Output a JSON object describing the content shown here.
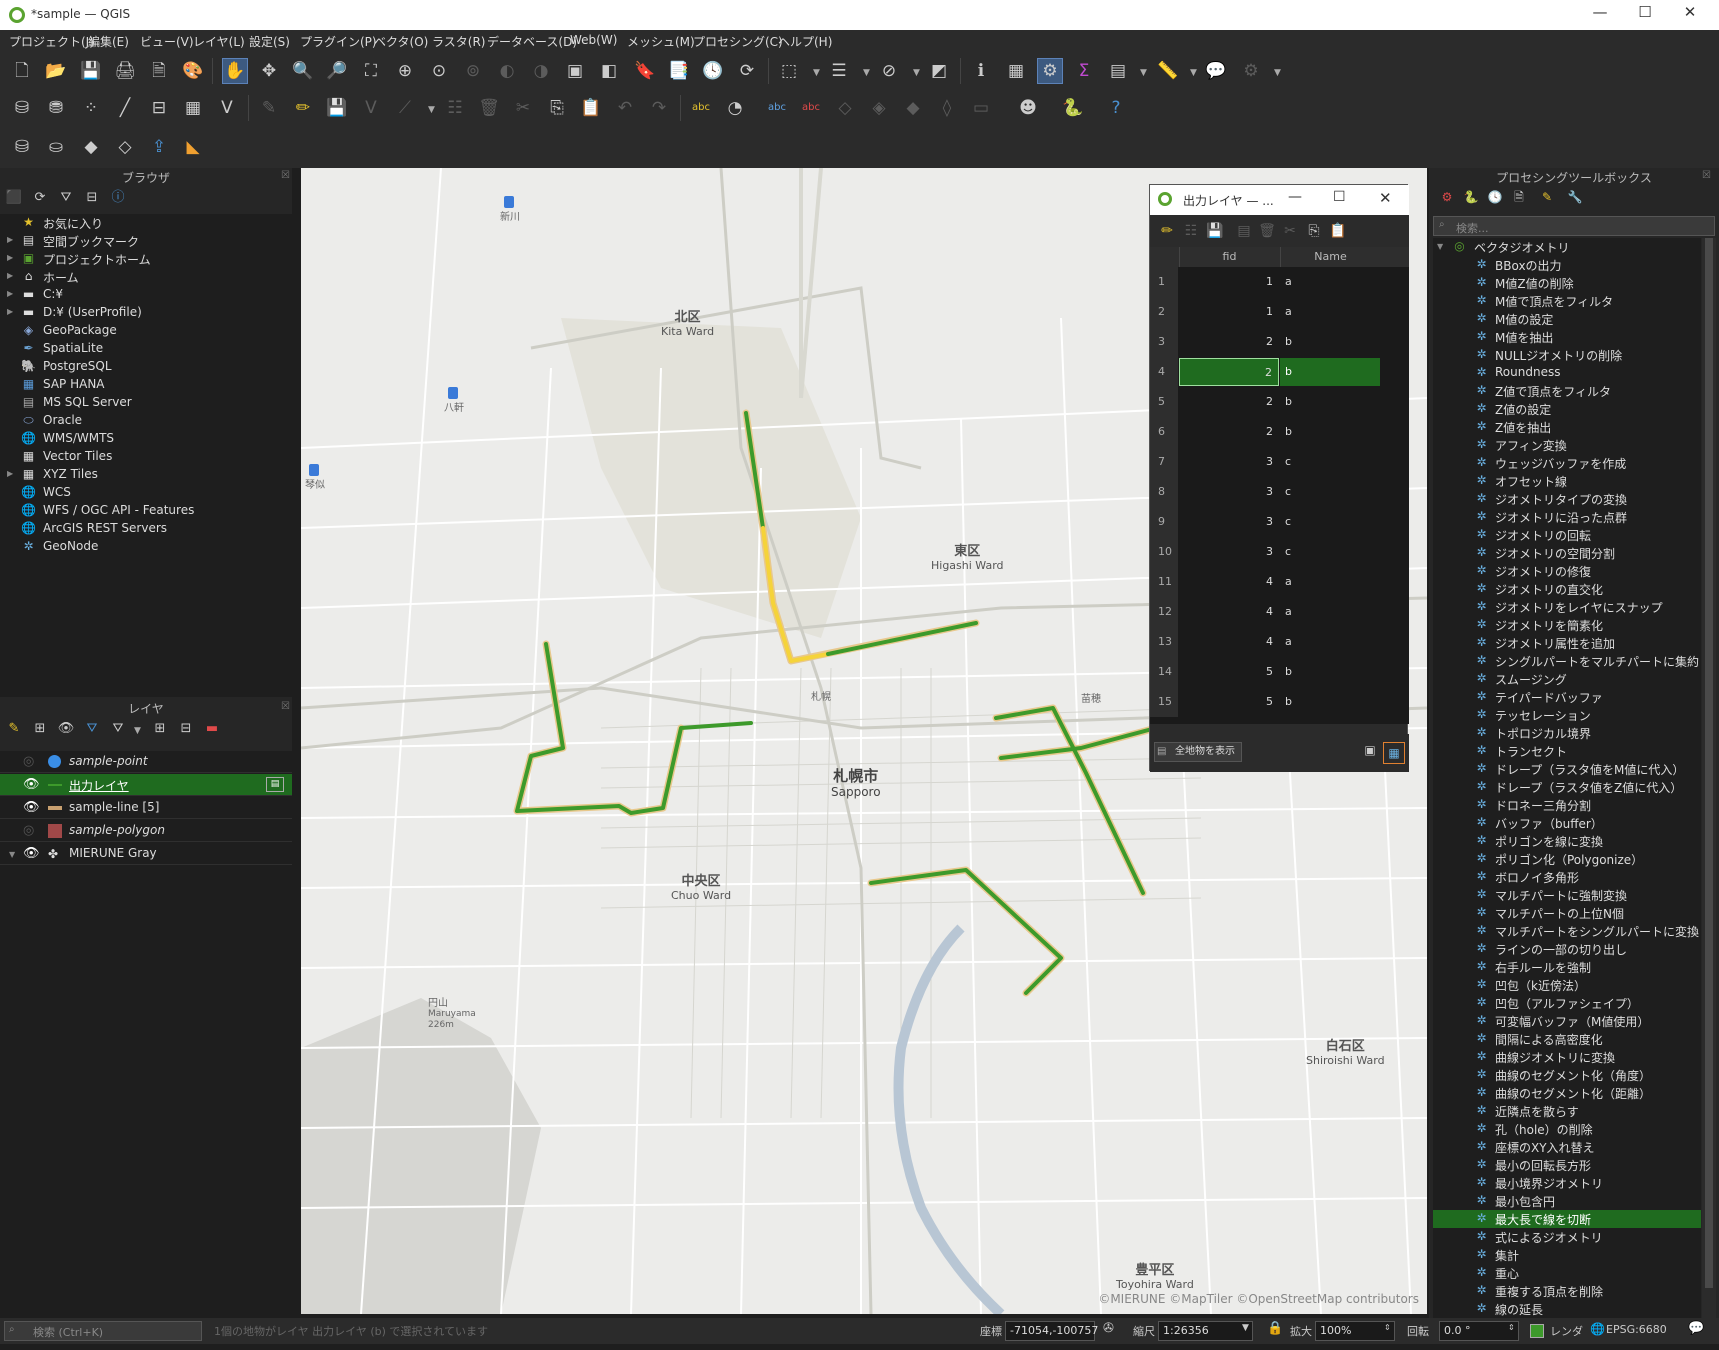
{
  "window": {
    "title": "*sample — QGIS",
    "minimize": "—",
    "maximize": "☐",
    "close": "✕"
  },
  "menu": [
    "プロジェクト(J)",
    "編集(E)",
    "ビュー(V)",
    "レイヤ(L)",
    "設定(S)",
    "プラグイン(P)",
    "ベクタ(O)",
    "ラスタ(R)",
    "データベース(D)",
    "Web(W)",
    "メッシュ(M)",
    "プロセシング(C)",
    "ヘルプ(H)"
  ],
  "browser": {
    "title": "ブラウザ",
    "items": [
      {
        "label": "お気に入り",
        "icon": "star-icon",
        "expand": false
      },
      {
        "label": "空間ブックマーク",
        "icon": "bookmark-icon",
        "expand": true
      },
      {
        "label": "プロジェクトホーム",
        "icon": "project-home-icon",
        "expand": true
      },
      {
        "label": "ホーム",
        "icon": "home-icon",
        "expand": true
      },
      {
        "label": "C:¥",
        "icon": "drive-icon",
        "expand": true
      },
      {
        "label": "D:¥ (UserProfile)",
        "icon": "drive-icon",
        "expand": true
      },
      {
        "label": "GeoPackage",
        "icon": "geopackage-icon",
        "expand": false
      },
      {
        "label": "SpatiaLite",
        "icon": "spatialite-icon",
        "expand": false
      },
      {
        "label": "PostgreSQL",
        "icon": "postgresql-icon",
        "expand": false
      },
      {
        "label": "SAP HANA",
        "icon": "hana-icon",
        "expand": false
      },
      {
        "label": "MS SQL Server",
        "icon": "mssql-icon",
        "expand": false
      },
      {
        "label": "Oracle",
        "icon": "oracle-icon",
        "expand": false
      },
      {
        "label": "WMS/WMTS",
        "icon": "globe-icon",
        "expand": false
      },
      {
        "label": "Vector Tiles",
        "icon": "vector-tiles-icon",
        "expand": false
      },
      {
        "label": "XYZ Tiles",
        "icon": "xyz-tiles-icon",
        "expand": true
      },
      {
        "label": "WCS",
        "icon": "wcs-icon",
        "expand": false
      },
      {
        "label": "WFS / OGC API - Features",
        "icon": "wfs-icon",
        "expand": false
      },
      {
        "label": "ArcGIS REST Servers",
        "icon": "arcgis-icon",
        "expand": false
      },
      {
        "label": "GeoNode",
        "icon": "geonode-icon",
        "expand": false
      }
    ]
  },
  "layers": {
    "title": "レイヤ",
    "items": [
      {
        "label": "sample-point",
        "visible": false,
        "italic": true,
        "selected": false,
        "symbol": "point"
      },
      {
        "label": "出力レイヤ",
        "visible": true,
        "italic": false,
        "selected": true,
        "symbol": "line"
      },
      {
        "label": "sample-line [5]",
        "visible": true,
        "italic": false,
        "selected": false,
        "symbol": "line-tan"
      },
      {
        "label": "sample-polygon",
        "visible": false,
        "italic": true,
        "selected": false,
        "symbol": "polygon"
      },
      {
        "label": "MIERUNE Gray",
        "visible": true,
        "italic": false,
        "selected": false,
        "symbol": "tiles"
      }
    ]
  },
  "map": {
    "labels": [
      {
        "t": "北区",
        "s": "Kita Ward"
      },
      {
        "t": "東区",
        "s": "Higashi Ward"
      },
      {
        "t": "札幌市",
        "s": "Sapporo"
      },
      {
        "t": "中央区",
        "s": "Chuo Ward"
      },
      {
        "t": "白石区",
        "s": "Shiroishi Ward"
      },
      {
        "t": "豊平区",
        "s": "Toyohira Ward"
      },
      {
        "t": "円山",
        "s": "Maruyama 226m"
      }
    ],
    "stations": [
      "新川",
      "八軒",
      "琴似",
      "札幌",
      "苗穂"
    ],
    "attribution": "©MIERUNE ©MapTiler ©OpenStreetMap contributors"
  },
  "attr_table": {
    "title": "出力レイヤ — ...",
    "cols": [
      "fid",
      "Name"
    ],
    "rows": [
      [
        "1",
        "1",
        "a"
      ],
      [
        "2",
        "1",
        "a"
      ],
      [
        "3",
        "2",
        "b"
      ],
      [
        "4",
        "2",
        "b"
      ],
      [
        "5",
        "2",
        "b"
      ],
      [
        "6",
        "2",
        "b"
      ],
      [
        "7",
        "3",
        "c"
      ],
      [
        "8",
        "3",
        "c"
      ],
      [
        "9",
        "3",
        "c"
      ],
      [
        "10",
        "3",
        "c"
      ],
      [
        "11",
        "4",
        "a"
      ],
      [
        "12",
        "4",
        "a"
      ],
      [
        "13",
        "4",
        "a"
      ],
      [
        "14",
        "5",
        "b"
      ],
      [
        "15",
        "5",
        "b"
      ]
    ],
    "selected_row": 4,
    "show_all": "全地物を表示"
  },
  "toolbox": {
    "title": "プロセシングツールボックス",
    "search_placeholder": "検索...",
    "group": "ベクタジオメトリ",
    "items": [
      "BBoxの出力",
      "M値Z値の削除",
      "M値で頂点をフィルタ",
      "M値の設定",
      "M値を抽出",
      "NULLジオメトリの削除",
      "Roundness",
      "Z値で頂点をフィルタ",
      "Z値の設定",
      "Z値を抽出",
      "アフィン変換",
      "ウェッジバッファを作成",
      "オフセット線",
      "ジオメトリタイプの変換",
      "ジオメトリに沿った点群",
      "ジオメトリの回転",
      "ジオメトリの空間分割",
      "ジオメトリの修復",
      "ジオメトリの直交化",
      "ジオメトリをレイヤにスナップ",
      "ジオメトリを簡素化",
      "ジオメトリ属性を追加",
      "シングルパートをマルチパートに集約",
      "スムージング",
      "テイパードバッファ",
      "テッセレーション",
      "トポロジカル境界",
      "トランセクト",
      "ドレープ（ラスタ値をM値に代入）",
      "ドレープ（ラスタ値をZ値に代入）",
      "ドロネー三角分割",
      "バッファ（buffer）",
      "ポリゴンを線に変換",
      "ポリゴン化（Polygonize）",
      "ボロノイ多角形",
      "マルチパートに強制変換",
      "マルチパートの上位N個",
      "マルチパートをシングルパートに変換",
      "ラインの一部の切り出し",
      "右手ルールを強制",
      "凹包（k近傍法）",
      "凹包（アルファシェイプ）",
      "可変幅バッファ（M値使用）",
      "間隔による高密度化",
      "曲線ジオメトリに変換",
      "曲線のセグメント化（角度）",
      "曲線のセグメント化（距離）",
      "近隣点を散らす",
      "孔（hole）の削除",
      "座標のXY入れ替え",
      "最小の回転長方形",
      "最小境界ジオメトリ",
      "最小包含円",
      "最大長で線を切断",
      "式によるジオメトリ",
      "集計",
      "重心",
      "重複する頂点を削除",
      "線の延長"
    ],
    "selected": "最大長で線を切断"
  },
  "status": {
    "locator_placeholder": "検索 (Ctrl+K)",
    "message": "1個の地物がレイヤ 出力レイヤ (b) で選択されています",
    "coord_label": "座標",
    "coord": "-71054,-100757",
    "scale_label": "縮尺",
    "scale": "1:26356",
    "magnify_label": "拡大",
    "magnify": "100%",
    "rotation_label": "回転",
    "rotation": "0.0 °",
    "render_label": "レンダ",
    "crs": "EPSG:6680"
  },
  "colors": {
    "accent_green": "#1f6b1f",
    "line_green": "#3d9a2b",
    "line_yellow": "#f5d33a"
  }
}
